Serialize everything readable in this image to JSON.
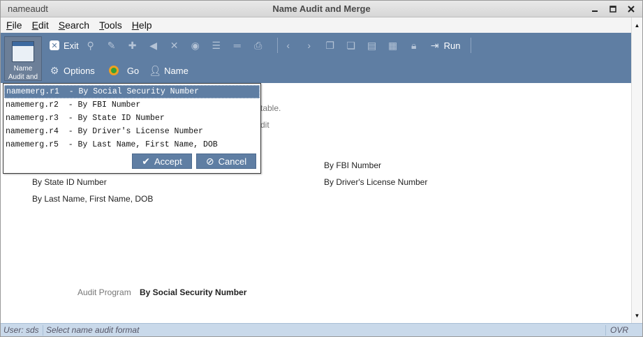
{
  "window": {
    "app_name": "nameaudt",
    "title": "Name Audit and Merge"
  },
  "menu": [
    {
      "label": "File",
      "u": "F",
      "rest": "ile"
    },
    {
      "label": "Edit",
      "u": "E",
      "rest": "dit"
    },
    {
      "label": "Search",
      "u": "S",
      "rest": "earch"
    },
    {
      "label": "Tools",
      "u": "T",
      "rest": "ools"
    },
    {
      "label": "Help",
      "u": "H",
      "rest": "elp"
    }
  ],
  "toolbar": {
    "launcher_label": "Name\nAudit and",
    "exit_label": "Exit",
    "run_label": "Run",
    "options_label": "Options",
    "go_label": "Go",
    "name_label": "Name"
  },
  "background": {
    "line1_tail": "table.",
    "line2_tail": "dit",
    "col2_item1": "By FBI Number",
    "col2_item2": "By Driver's License Number",
    "col1_item1": "By State ID Number",
    "col1_item2": "By Last Name, First Name, DOB",
    "audit_program_label": "Audit Program",
    "audit_program_value": "By Social Security Number"
  },
  "popup": {
    "options": [
      "namemerg.r1  - By Social Security Number",
      "namemerg.r2  - By FBI Number",
      "namemerg.r3  - By State ID Number",
      "namemerg.r4  - By Driver's License Number",
      "namemerg.r5  - By Last Name, First Name, DOB"
    ],
    "selected_index": 0,
    "accept_label": "Accept",
    "cancel_label": "Cancel"
  },
  "status": {
    "user": "User: sds",
    "message": "Select name audit format",
    "mode": "OVR"
  }
}
